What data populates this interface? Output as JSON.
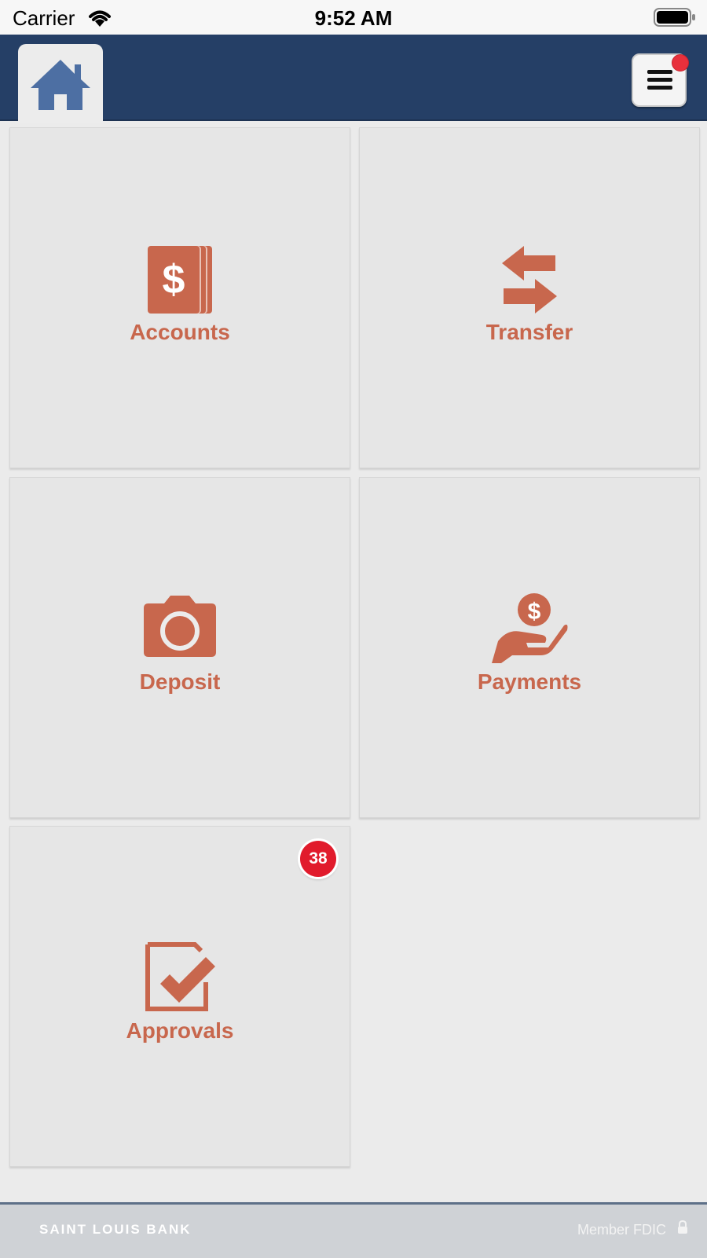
{
  "status_bar": {
    "carrier": "Carrier",
    "time": "9:52 AM",
    "wifi_icon": "wifi-icon",
    "battery_icon": "battery-icon"
  },
  "nav": {
    "home_icon": "home-icon",
    "menu_icon": "menu-icon",
    "has_notification": true
  },
  "tiles": [
    {
      "label": "Accounts",
      "icon": "dollar-cards-icon"
    },
    {
      "label": "Transfer",
      "icon": "transfer-arrows-icon"
    },
    {
      "label": "Deposit",
      "icon": "camera-icon"
    },
    {
      "label": "Payments",
      "icon": "hand-coin-icon"
    },
    {
      "label": "Approvals",
      "icon": "checkbox-icon",
      "badge": "38"
    }
  ],
  "footer": {
    "brand": "SAINT LOUIS BANK",
    "fdic": "Member FDIC",
    "lock_icon": "lock-icon"
  },
  "colors": {
    "nav_bg": "#253f66",
    "accent": "#c8674d",
    "badge": "#e11b2c"
  }
}
